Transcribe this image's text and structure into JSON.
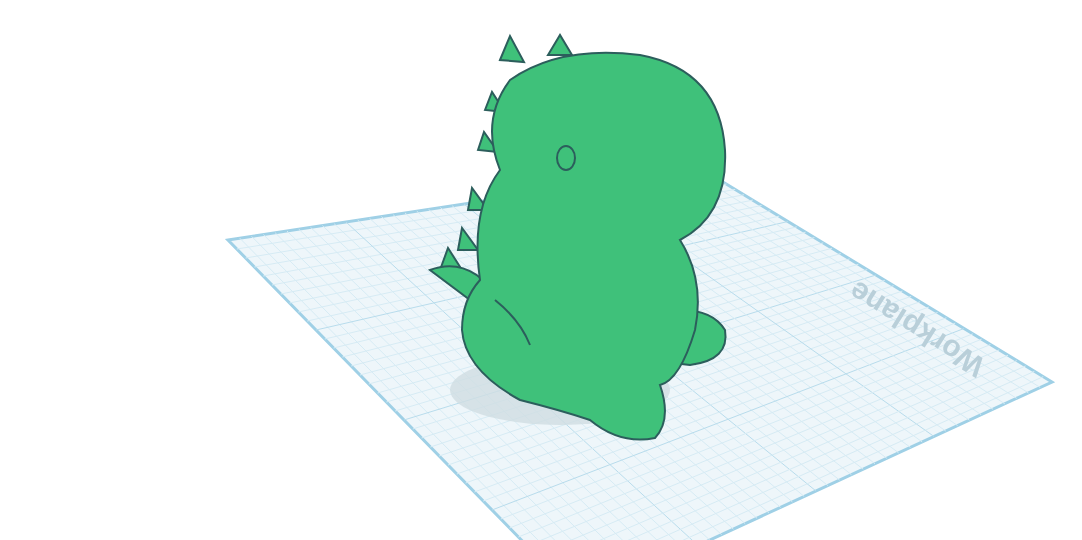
{
  "workplane": {
    "label": "Workplane"
  }
}
